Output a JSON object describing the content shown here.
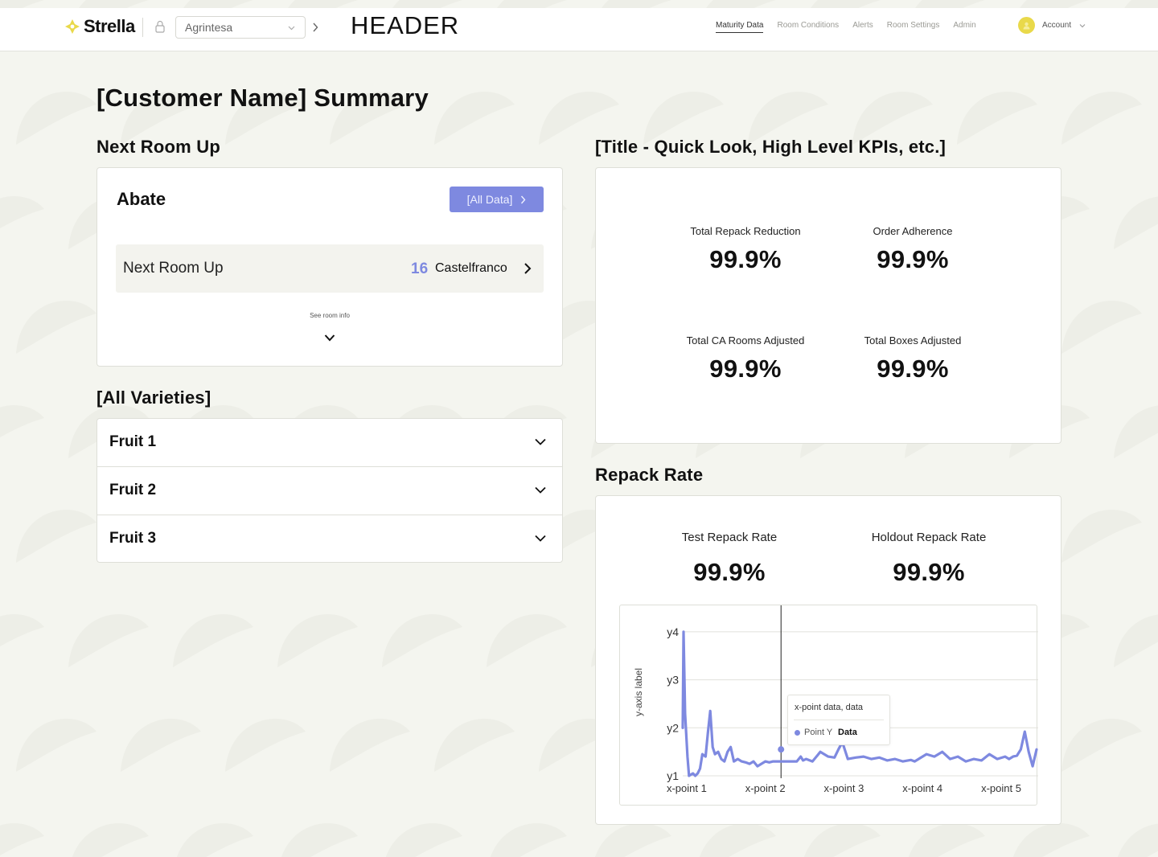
{
  "header": {
    "logo_text": "Strella",
    "org_select_value": "Agrintesa",
    "title": "HEADER",
    "nav": [
      "Maturity Data",
      "Room Conditions",
      "Alerts",
      "Room Settings",
      "Admin"
    ],
    "account_label": "Account",
    "accent_color": "#7e89e0",
    "logo_color": "#e9d94a"
  },
  "page": {
    "title": "[Customer Name] Summary"
  },
  "next_room": {
    "section_title": "Next Room Up",
    "room_name": "Abate",
    "all_data_label": "[All Data]",
    "row_label": "Next Room Up",
    "room_number": "16",
    "room_title": "Castelfranco",
    "see_room_info": "See room info"
  },
  "varieties": {
    "section_title": "[All Varieties]",
    "items": [
      "Fruit 1",
      "Fruit 2",
      "Fruit 3"
    ]
  },
  "kpis": {
    "section_title": "[Title - Quick Look, High Level KPIs, etc.]",
    "items": [
      {
        "label": "Total Repack Reduction",
        "value": "99.9%"
      },
      {
        "label": "Order Adherence",
        "value": "99.9%"
      },
      {
        "label": "Total CA Rooms Adjusted",
        "value": "99.9%"
      },
      {
        "label": "Total Boxes Adjusted",
        "value": "99.9%"
      }
    ]
  },
  "repack": {
    "section_title": "Repack Rate",
    "test_label": "Test Repack Rate",
    "test_value": "99.9%",
    "holdout_label": "Holdout Repack Rate",
    "holdout_value": "99.9%"
  },
  "chart_data": {
    "type": "line",
    "ylabel": "y-axis label",
    "xlabel": "",
    "x_ticks": [
      "x-point 1",
      "x-point 2",
      "x-point 3",
      "x-point 4",
      "x-point 5"
    ],
    "y_ticks": [
      "y1",
      "y2",
      "y3",
      "y4"
    ],
    "ylim": [
      0.95,
      4.45
    ],
    "xlim": [
      0.95,
      5.45
    ],
    "grid": "horizontal",
    "line_color": "#7e89e0",
    "series": [
      {
        "x": [
          0.95,
          0.96,
          0.98,
          1.0,
          1.01,
          1.03,
          1.05,
          1.08,
          1.11,
          1.14,
          1.17,
          1.2,
          1.24,
          1.27,
          1.3,
          1.33,
          1.36,
          1.4,
          1.44,
          1.48,
          1.52,
          1.56,
          1.6,
          1.65,
          1.7,
          1.75,
          1.8,
          1.85,
          1.9,
          1.95,
          2.0,
          2.05,
          2.1,
          2.15,
          2.2,
          2.3,
          2.4,
          2.45,
          2.48,
          2.52,
          2.6,
          2.7,
          2.8,
          2.88,
          2.93,
          2.98,
          3.05,
          3.15,
          3.25,
          3.35,
          3.45,
          3.55,
          3.65,
          3.75,
          3.85,
          3.9,
          3.95,
          4.05,
          4.15,
          4.25,
          4.35,
          4.45,
          4.55,
          4.65,
          4.75,
          4.85,
          4.95,
          5.05,
          5.1,
          5.15,
          5.2,
          5.25,
          5.3,
          5.35,
          5.4,
          5.45
        ],
        "y": [
          2.0,
          4.0,
          2.3,
          1.7,
          1.4,
          1.0,
          1.02,
          1.05,
          1.0,
          1.05,
          1.15,
          1.45,
          1.4,
          1.9,
          2.35,
          1.6,
          1.45,
          1.5,
          1.35,
          1.3,
          1.5,
          1.6,
          1.3,
          1.35,
          1.3,
          1.28,
          1.25,
          1.3,
          1.2,
          1.25,
          1.3,
          1.28,
          1.3,
          1.3,
          1.3,
          1.3,
          1.3,
          1.4,
          1.32,
          1.35,
          1.3,
          1.5,
          1.4,
          1.38,
          1.55,
          1.7,
          1.35,
          1.38,
          1.4,
          1.35,
          1.38,
          1.32,
          1.35,
          1.3,
          1.33,
          1.3,
          1.35,
          1.45,
          1.4,
          1.5,
          1.35,
          1.4,
          1.3,
          1.35,
          1.32,
          1.45,
          1.35,
          1.4,
          1.35,
          1.4,
          1.42,
          1.55,
          1.92,
          1.5,
          1.2,
          1.55
        ]
      }
    ],
    "highlight": {
      "x": 2.2,
      "y": 1.55
    },
    "tooltip": {
      "title": "x-point data, data",
      "series_label": "Point Y",
      "value": "Data"
    }
  }
}
